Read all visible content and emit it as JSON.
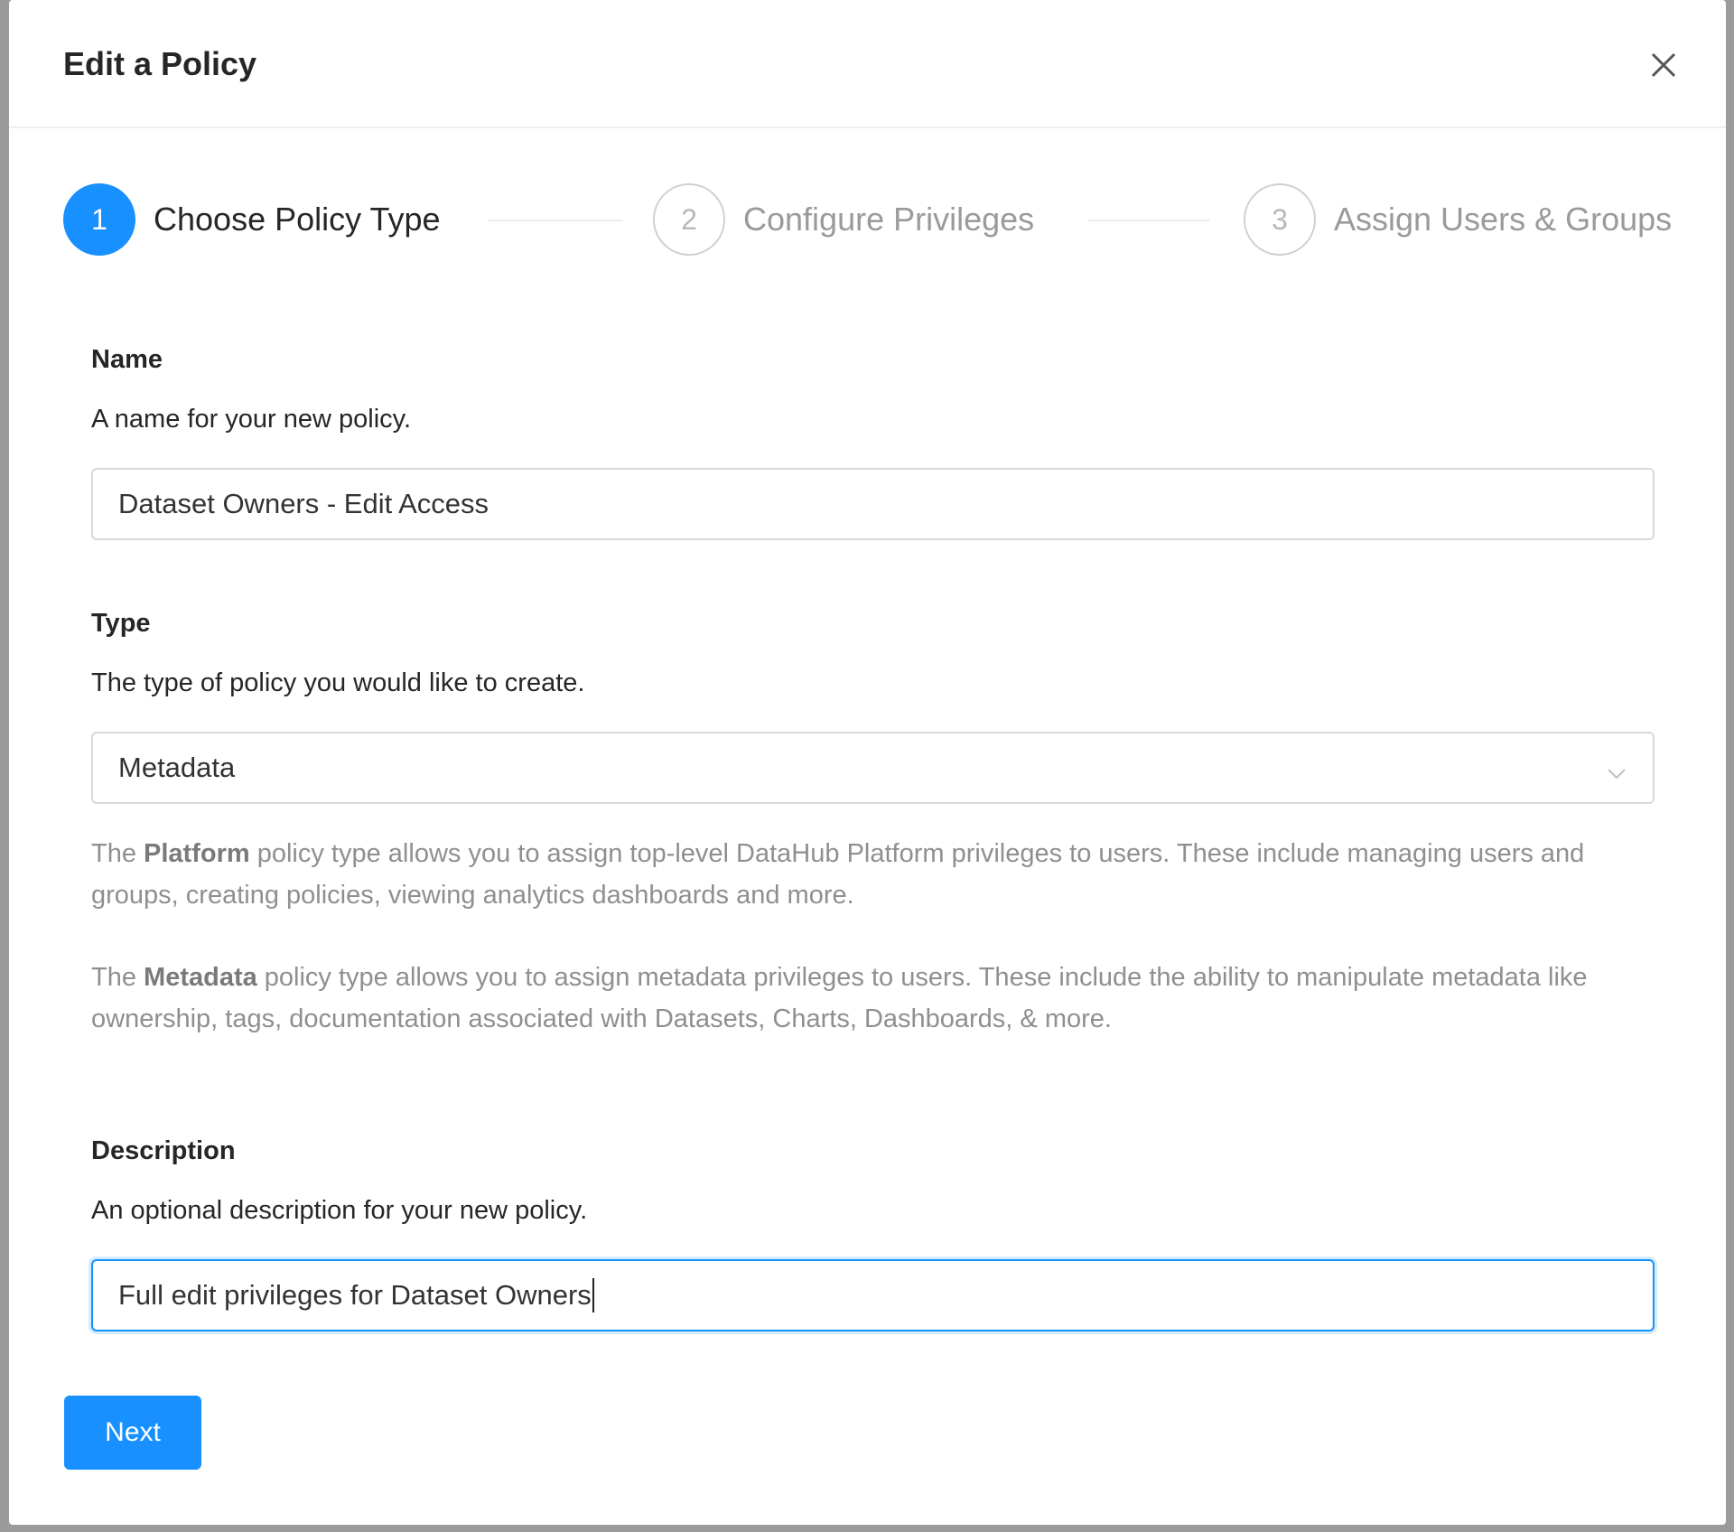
{
  "modal": {
    "title": "Edit a Policy",
    "close_icon": "close-icon"
  },
  "steps": [
    {
      "number": "1",
      "label": "Choose Policy Type",
      "state": "active"
    },
    {
      "number": "2",
      "label": "Configure Privileges",
      "state": "inactive"
    },
    {
      "number": "3",
      "label": "Assign Users & Groups",
      "state": "inactive"
    }
  ],
  "name_field": {
    "label": "Name",
    "help": "A name for your new policy.",
    "value": "Dataset Owners - Edit Access"
  },
  "type_field": {
    "label": "Type",
    "help": "The type of policy you would like to create.",
    "selected": "Metadata",
    "arrow_icon": "chevron-down-icon",
    "platform_desc": {
      "prefix": "The ",
      "bold": "Platform",
      "suffix": " policy type allows you to assign top-level DataHub Platform privileges to users. These include managing users and groups, creating policies, viewing analytics dashboards and more."
    },
    "metadata_desc": {
      "prefix": "The ",
      "bold": "Metadata",
      "suffix": " policy type allows you to assign metadata privileges to users. These include the ability to manipulate metadata like ownership, tags, documentation associated with Datasets, Charts, Dashboards, & more."
    }
  },
  "description_field": {
    "label": "Description",
    "help": "An optional description for your new policy.",
    "value": "Full edit privileges for Dataset Owners"
  },
  "next_button": "Next",
  "colors": {
    "primary": "#1890ff",
    "text": "#262626",
    "muted": "#8f8f8f"
  }
}
